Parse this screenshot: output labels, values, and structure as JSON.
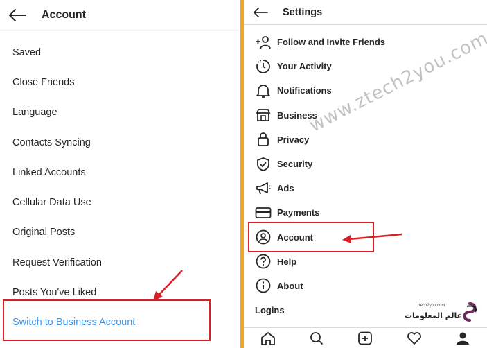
{
  "left": {
    "title": "Account",
    "items": [
      {
        "label": "Saved"
      },
      {
        "label": "Close Friends"
      },
      {
        "label": "Language"
      },
      {
        "label": "Contacts Syncing"
      },
      {
        "label": "Linked Accounts"
      },
      {
        "label": "Cellular Data Use"
      },
      {
        "label": "Original Posts"
      },
      {
        "label": "Request Verification"
      },
      {
        "label": "Posts You've Liked"
      },
      {
        "label": "Switch to Business Account"
      }
    ]
  },
  "right": {
    "title": "Settings",
    "items": [
      {
        "label": "Follow and Invite Friends",
        "icon": "add-person-icon"
      },
      {
        "label": "Your Activity",
        "icon": "activity-icon"
      },
      {
        "label": "Notifications",
        "icon": "bell-icon"
      },
      {
        "label": "Business",
        "icon": "store-icon"
      },
      {
        "label": "Privacy",
        "icon": "lock-icon"
      },
      {
        "label": "Security",
        "icon": "shield-icon"
      },
      {
        "label": "Ads",
        "icon": "megaphone-icon"
      },
      {
        "label": "Payments",
        "icon": "card-icon"
      },
      {
        "label": "Account",
        "icon": "account-icon"
      },
      {
        "label": "Help",
        "icon": "help-icon"
      },
      {
        "label": "About",
        "icon": "info-icon"
      },
      {
        "label": "Logins",
        "icon": ""
      }
    ],
    "tabbar": [
      "home-icon",
      "search-icon",
      "add-icon",
      "heart-icon",
      "profile-icon"
    ]
  },
  "watermark": "www.ztech2you.com",
  "logo": {
    "small": "ztech2you.com",
    "arabic": "عالم المعلومات"
  },
  "colors": {
    "highlight": "#d81f26",
    "link": "#3897f0",
    "divider": "#f5a623"
  }
}
